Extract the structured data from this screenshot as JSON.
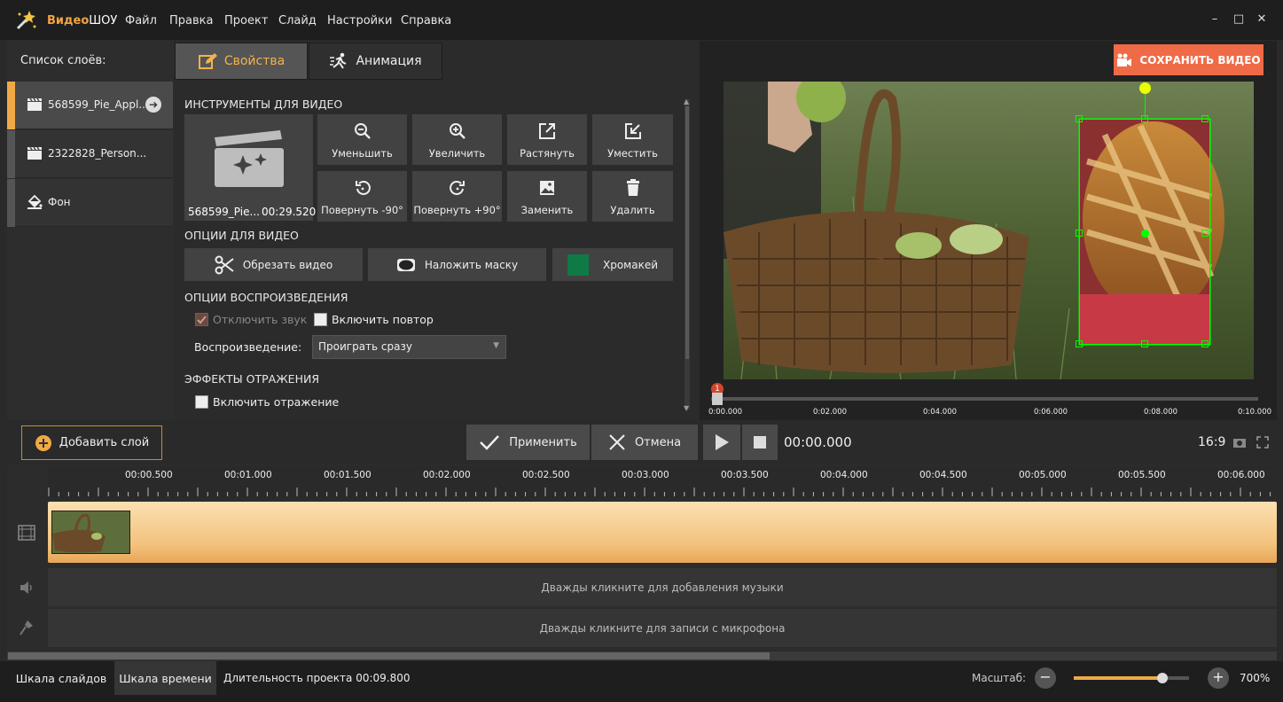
{
  "app": {
    "name_a": "Видео",
    "name_b": "ШОУ"
  },
  "menu": [
    "Файл",
    "Правка",
    "Проект",
    "Слайд",
    "Настройки",
    "Справка"
  ],
  "window": {
    "minimize": "–",
    "maximize": "□",
    "close": "✕"
  },
  "layers": {
    "title": "Список слоёв:",
    "items": [
      {
        "label": "568599_Pie_Appl...",
        "icon": "clapper-icon",
        "selected": true
      },
      {
        "label": "2322828_Person...",
        "icon": "clapper-icon",
        "selected": false
      },
      {
        "label": "Фон",
        "icon": "paint-bucket-icon",
        "selected": false
      }
    ]
  },
  "tabs": {
    "properties": "Свойства",
    "animation": "Анимация"
  },
  "tools": {
    "title": "ИНСТРУМЕНТЫ ДЛЯ ВИДЕО",
    "thumb_name": "568599_Pie...",
    "thumb_time": "00:29.520",
    "buttons": [
      {
        "label": "Уменьшить",
        "icon": "zoom-out-icon"
      },
      {
        "label": "Увеличить",
        "icon": "zoom-in-icon"
      },
      {
        "label": "Растянуть",
        "icon": "stretch-icon"
      },
      {
        "label": "Уместить",
        "icon": "fit-icon"
      },
      {
        "label": "Повернуть -90°",
        "icon": "rotate-left-icon"
      },
      {
        "label": "Повернуть +90°",
        "icon": "rotate-right-icon"
      },
      {
        "label": "Заменить",
        "icon": "replace-image-icon"
      },
      {
        "label": "Удалить",
        "icon": "trash-icon"
      }
    ]
  },
  "video_options": {
    "title": "ОПЦИИ ДЛЯ ВИДЕО",
    "crop": "Обрезать видео",
    "mask": "Наложить маску",
    "chroma": "Хромакей",
    "chroma_color": "#0f7a45"
  },
  "playback": {
    "title": "ОПЦИИ ВОСПРОИЗВЕДЕНИЯ",
    "mute": "Отключить звук",
    "mute_checked": true,
    "loop": "Включить повтор",
    "loop_checked": false,
    "mode_label": "Воспроизведение:",
    "mode_value": "Проиграть сразу"
  },
  "reflection": {
    "title": "ЭФФЕКТЫ ОТРАЖЕНИЯ",
    "enable": "Включить отражение",
    "checked": false
  },
  "save_button": "СОХРАНИТЬ ВИДЕО",
  "preview_ruler": {
    "marker": "1",
    "labels": [
      "0:00.000",
      "0:02.000",
      "0:04.000",
      "0:06.000",
      "0:08.000",
      "0:10.000"
    ]
  },
  "controls": {
    "add_layer": "Добавить слой",
    "apply": "Применить",
    "cancel": "Отмена",
    "time": "00:00.000",
    "aspect": "16:9"
  },
  "timeline": {
    "labels": [
      "00:00.500",
      "00:01.000",
      "00:01.500",
      "00:02.000",
      "00:02.500",
      "00:03.000",
      "00:03.500",
      "00:04.000",
      "00:04.500",
      "00:05.000",
      "00:05.500",
      "00:06.000"
    ],
    "music_hint": "Дважды кликните для добавления музыки",
    "mic_hint": "Дважды кликните для записи с микрофона"
  },
  "bottom": {
    "slides_tab": "Шкала слайдов",
    "time_tab": "Шкала времени",
    "duration": "Длительность проекта 00:09.800",
    "scale_label": "Масштаб:",
    "zoom": "700%",
    "zoom_fraction": 0.77
  },
  "colors": {
    "accent": "#f0a946",
    "save": "#ef6a46",
    "selection": "#00ff00"
  }
}
